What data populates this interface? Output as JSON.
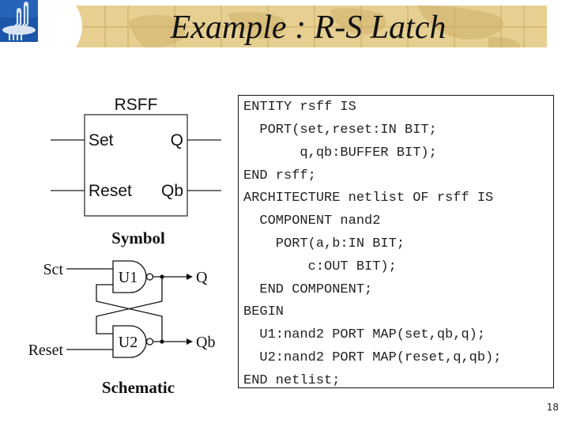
{
  "slide": {
    "title": "Example : R-S Latch",
    "page_number": "18",
    "colors": {
      "banner_bg": "#e6cf91",
      "banner_grid": "#c9ab62",
      "logo_bg": "#1c56a8",
      "logo_fg": "#d9e4f3"
    }
  },
  "symbol": {
    "block_name": "RSFF",
    "ports": {
      "set": "Set",
      "reset": "Reset",
      "q": "Q",
      "qb": "Qb"
    },
    "caption": "Symbol"
  },
  "schematic": {
    "inputs": {
      "set": "Sct",
      "reset": "Reset"
    },
    "gates": {
      "u1": "U1",
      "u2": "U2"
    },
    "outputs": {
      "q": "Q",
      "qb": "Qb"
    },
    "caption": "Schematic"
  },
  "code": {
    "lines": [
      "ENTITY rsff IS",
      "  PORT(set,reset:IN BIT;",
      "       q,qb:BUFFER BIT);",
      "END rsff;",
      "ARCHITECTURE netlist OF rsff IS",
      "  COMPONENT nand2",
      "    PORT(a,b:IN BIT;",
      "        c:OUT BIT);",
      "  END COMPONENT;",
      "BEGIN",
      "  U1:nand2 PORT MAP(set,qb,q);",
      "  U2:nand2 PORT MAP(reset,q,qb);",
      "END netlist;"
    ]
  }
}
